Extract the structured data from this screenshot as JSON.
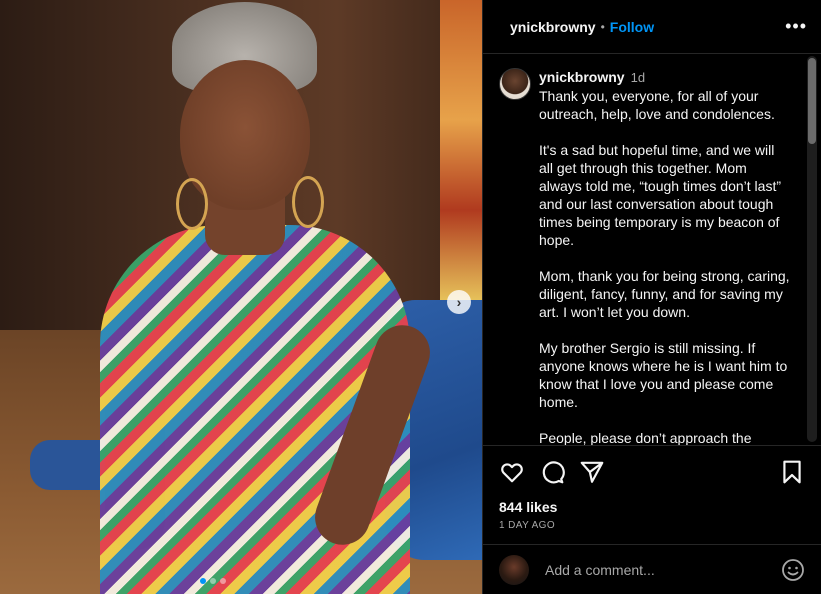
{
  "post": {
    "username": "ynickbrowny",
    "separator": "•",
    "follow_label": "Follow",
    "more_icon": "more-options-icon",
    "more_glyph": "•••",
    "carousel_next_glyph": "›"
  },
  "caption": {
    "username": "ynickbrowny",
    "age": "1d",
    "paragraphs": [
      "Thank you, everyone, for all of your outreach, help, love and condolences.",
      "It's a sad but hopeful time, and we will all get through this together. Mom always told me, “tough times don’t last” and our last conversation about tough times being temporary is my beacon of hope.",
      "Mom, thank you for being strong, caring, diligent, fancy, funny, and for saving my art. I won’t let you down.",
      "My brother Sergio is still missing. If anyone knows where he is I want him to know that I love you and please come home.",
      "People, please don’t approach the"
    ]
  },
  "engagement": {
    "likes": "844 likes",
    "time_ago": "1 DAY AGO"
  },
  "comment_box": {
    "placeholder": "Add a comment..."
  },
  "colors": {
    "background": "#000000",
    "accent": "#0095f6",
    "muted_text": "#a8a8a8",
    "divider": "#262626"
  },
  "icons": {
    "like": "heart-icon",
    "comment": "comment-bubble-icon",
    "share": "paper-plane-icon",
    "save": "bookmark-icon",
    "emoji": "smiley-face-icon"
  }
}
